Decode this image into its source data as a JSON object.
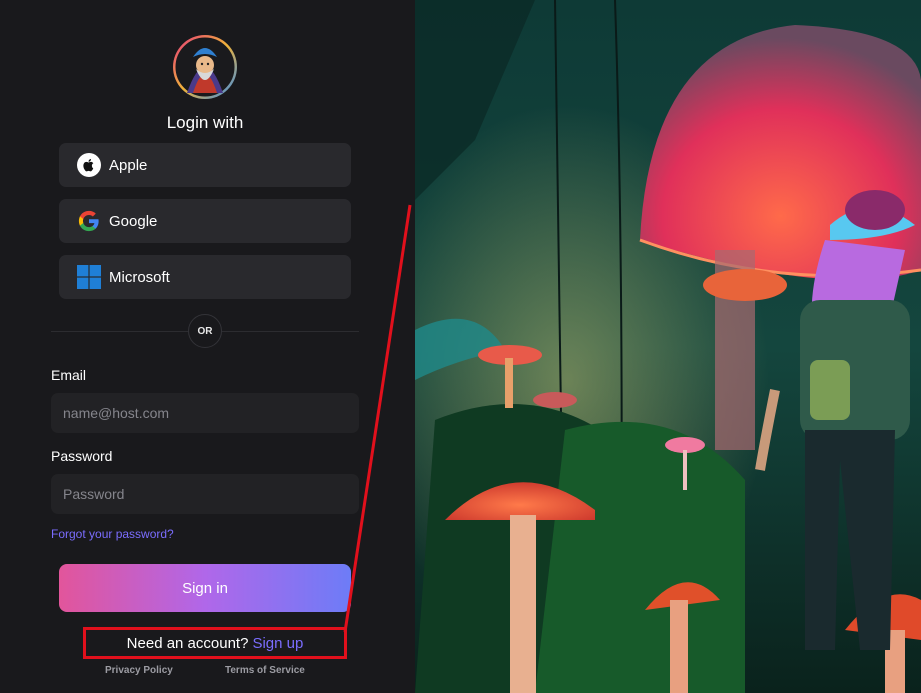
{
  "login": {
    "title": "Login with",
    "providers": [
      {
        "label": "Apple",
        "icon": "apple-icon"
      },
      {
        "label": "Google",
        "icon": "google-icon"
      },
      {
        "label": "Microsoft",
        "icon": "microsoft-icon"
      }
    ],
    "divider_label": "OR",
    "email": {
      "label": "Email",
      "placeholder": "name@host.com"
    },
    "password": {
      "label": "Password",
      "placeholder": "Password"
    },
    "forgot_label": "Forgot your password?",
    "signin_label": "Sign in",
    "need_account_text": "Need an account?",
    "signup_label": "Sign up",
    "footer": {
      "privacy": "Privacy Policy",
      "terms": "Terms of Service"
    }
  },
  "colors": {
    "panel_bg": "#19191c",
    "button_bg": "#29292d",
    "input_bg": "#222225",
    "link": "#7b6dff",
    "gradient_start": "#e2559b",
    "gradient_end": "#6d7cf7",
    "highlight": "#e1101c"
  }
}
